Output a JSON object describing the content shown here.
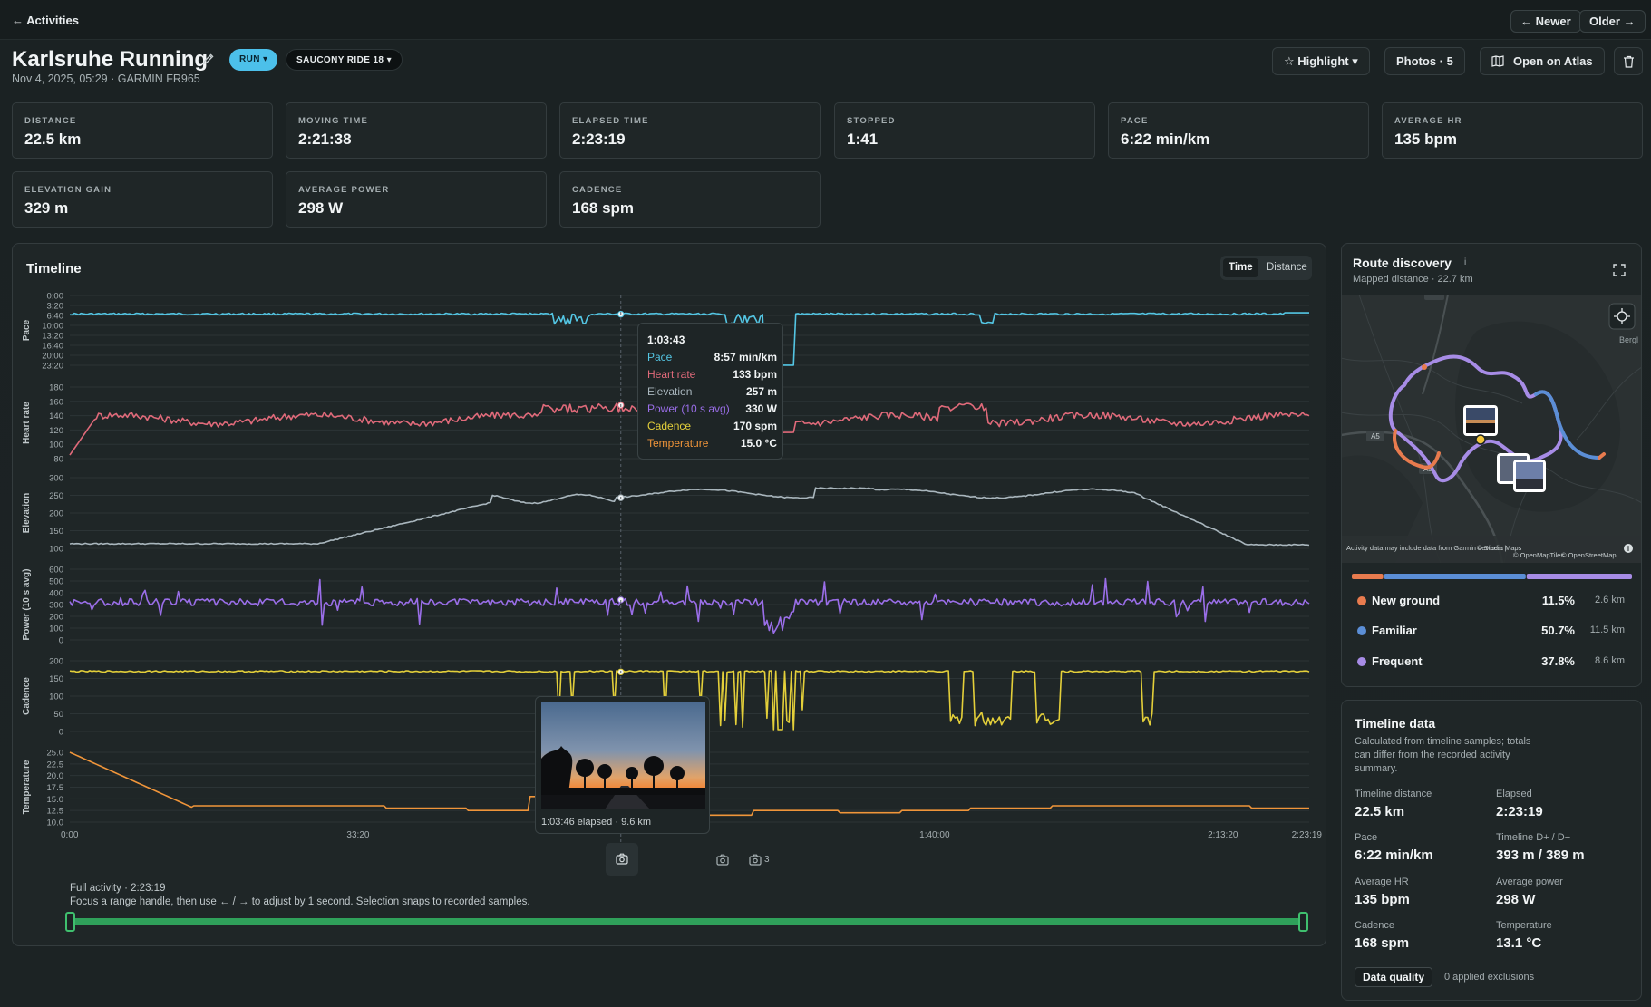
{
  "topbar": {
    "back_label": "← Activities",
    "newer_label": "← Newer",
    "older_label": "Older →"
  },
  "header": {
    "title": "Karlsruhe Running",
    "sport_pill": "RUN ▾",
    "shoe_pill": "SAUCONY RIDE 18 ▾",
    "subtitle": "Nov 4, 2025, 05:29 · GARMIN FR965",
    "highlight_label": "☆ Highlight ▾",
    "photos_label": "Photos · 5",
    "atlas_label": "Open on Atlas"
  },
  "stats": [
    {
      "label": "DISTANCE",
      "value": "22.5 km"
    },
    {
      "label": "MOVING TIME",
      "value": "2:21:38"
    },
    {
      "label": "ELAPSED TIME",
      "value": "2:23:19"
    },
    {
      "label": "STOPPED",
      "value": "1:41"
    },
    {
      "label": "PACE",
      "value": "6:22 min/km"
    },
    {
      "label": "AVERAGE HR",
      "value": "135 bpm"
    },
    {
      "label": "ELEVATION GAIN",
      "value": "329 m"
    },
    {
      "label": "AVERAGE POWER",
      "value": "298 W"
    },
    {
      "label": "CADENCE",
      "value": "168 spm"
    }
  ],
  "timeline": {
    "title": "Timeline",
    "mode_time": "Time",
    "mode_distance": "Distance",
    "total_seconds": 8599,
    "cursor_seconds": 3823,
    "charts": [
      {
        "name": "Pace",
        "color": "#54c6e4",
        "ticks": [
          "0:00",
          "3:20",
          "6:40",
          "10:00",
          "13:20",
          "16:40",
          "20:00",
          "23:20"
        ],
        "tick_values": [
          0,
          3.33,
          6.67,
          10,
          13.33,
          16.67,
          20,
          23.33
        ],
        "min": 0,
        "max": 23.33,
        "inverted": true
      },
      {
        "name": "Heart rate",
        "color": "#e06a7a",
        "ticks": [
          "80",
          "100",
          "120",
          "140",
          "160",
          "180"
        ],
        "tick_values": [
          80,
          100,
          120,
          140,
          160,
          180
        ],
        "min": 80,
        "max": 180
      },
      {
        "name": "Elevation",
        "color": "#a9b6bd",
        "ticks": [
          "100",
          "150",
          "200",
          "250",
          "300"
        ],
        "tick_values": [
          100,
          150,
          200,
          250,
          300
        ],
        "min": 100,
        "max": 300
      },
      {
        "name": "Power (10 s avg)",
        "color": "#9a6ee8",
        "ticks": [
          "0",
          "100",
          "200",
          "300",
          "400",
          "500",
          "600"
        ],
        "tick_values": [
          0,
          100,
          200,
          300,
          400,
          500,
          600
        ],
        "min": 0,
        "max": 600
      },
      {
        "name": "Cadence",
        "color": "#e3cf3a",
        "ticks": [
          "0",
          "50",
          "100",
          "150",
          "200"
        ],
        "tick_values": [
          0,
          50,
          100,
          150,
          200
        ],
        "min": 0,
        "max": 200
      },
      {
        "name": "Temperature",
        "color": "#f0953a",
        "ticks": [
          "10.0",
          "12.5",
          "15.0",
          "17.5",
          "20.0",
          "22.5",
          "25.0"
        ],
        "tick_values": [
          10,
          12.5,
          15,
          17.5,
          20,
          22.5,
          25
        ],
        "min": 10,
        "max": 25
      }
    ],
    "x_ticks": [
      {
        "label": "0:00",
        "sec": 0
      },
      {
        "label": "33:20",
        "sec": 2000
      },
      {
        "label": "1:40:00",
        "sec": 6000
      },
      {
        "label": "2:13:20",
        "sec": 8000
      },
      {
        "label": "2:23:19",
        "sec": 8599
      }
    ],
    "tooltip": {
      "time": "1:03:43",
      "rows": [
        {
          "key": "Pace",
          "value": "8:57 min/km",
          "color": "#54c6e4"
        },
        {
          "key": "Heart rate",
          "value": "133 bpm",
          "color": "#e06a7a"
        },
        {
          "key": "Elevation",
          "value": "257 m",
          "color": "#a9b6bd"
        },
        {
          "key": "Power (10 s avg)",
          "value": "330 W",
          "color": "#9a6ee8"
        },
        {
          "key": "Cadence",
          "value": "170 spm",
          "color": "#e3cf3a"
        },
        {
          "key": "Temperature",
          "value": "15.0 °C",
          "color": "#f0953a"
        }
      ]
    },
    "photo_popover_caption": "1:03:46 elapsed · 9.6 km",
    "photo_marker_count": "3",
    "range": {
      "title": "Full activity · 2:23:19",
      "hint": "Focus a range handle, then use ← / → to adjust by 1 second. Selection snaps to recorded samples."
    }
  },
  "route": {
    "title": "Route discovery",
    "info_glyph": "i",
    "subtitle": "Mapped distance · 22.7 km",
    "road_a5": "A5",
    "place_label": "Bergl",
    "attribution": "Activity data may include data from Garmin devices. |",
    "attribution_maps": "© Stadia Maps",
    "attribution_omt": "© OpenMapTiles",
    "attribution_osm": "© OpenStreetMap",
    "categories": [
      {
        "name": "New ground",
        "percent": "11.5%",
        "km": "2.6 km",
        "fraction": 0.115,
        "color": "#e87b4e"
      },
      {
        "name": "Familiar",
        "percent": "50.7%",
        "km": "11.5 km",
        "fraction": 0.507,
        "color": "#5b8ed6"
      },
      {
        "name": "Frequent",
        "percent": "37.8%",
        "km": "8.6 km",
        "fraction": 0.378,
        "color": "#a78ce6"
      }
    ]
  },
  "timeline_data": {
    "title": "Timeline data",
    "description": "Calculated from timeline samples; totals can differ from the recorded activity summary.",
    "items": [
      {
        "label": "Timeline distance",
        "value": "22.5 km"
      },
      {
        "label": "Elapsed",
        "value": "2:23:19"
      },
      {
        "label": "Pace",
        "value": "6:22 min/km"
      },
      {
        "label": "Timeline D+ / D−",
        "value": "393 m / 389 m"
      },
      {
        "label": "Average HR",
        "value": "135 bpm"
      },
      {
        "label": "Average power",
        "value": "298 W"
      },
      {
        "label": "Cadence",
        "value": "168 spm"
      },
      {
        "label": "Temperature",
        "value": "13.1 °C"
      }
    ],
    "data_quality_label": "Data quality",
    "exclusions_text": "0 applied exclusions"
  }
}
